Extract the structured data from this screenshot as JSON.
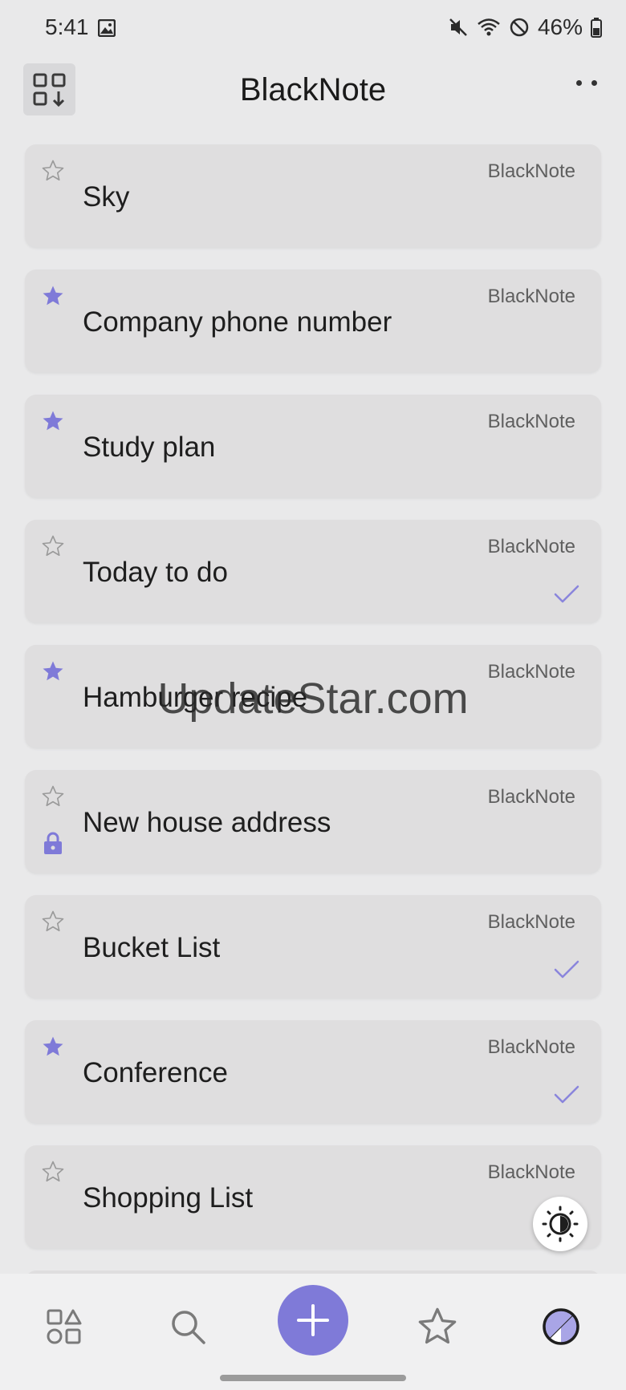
{
  "status_bar": {
    "time": "5:41",
    "battery": "46%"
  },
  "app_bar": {
    "title": "BlackNote"
  },
  "notes": [
    {
      "title": "Sky",
      "folder": "BlackNote",
      "starred": false,
      "checked": false,
      "locked": false
    },
    {
      "title": "Company phone number",
      "folder": "BlackNote",
      "starred": true,
      "checked": false,
      "locked": false
    },
    {
      "title": "Study plan",
      "folder": "BlackNote",
      "starred": true,
      "checked": false,
      "locked": false
    },
    {
      "title": "Today to do",
      "folder": "BlackNote",
      "starred": false,
      "checked": true,
      "locked": false
    },
    {
      "title": "Hamburger recipe",
      "folder": "BlackNote",
      "starred": true,
      "checked": false,
      "locked": false
    },
    {
      "title": "New house address",
      "folder": "BlackNote",
      "starred": false,
      "checked": false,
      "locked": true
    },
    {
      "title": "Bucket List",
      "folder": "BlackNote",
      "starred": false,
      "checked": true,
      "locked": false
    },
    {
      "title": "Conference",
      "folder": "BlackNote",
      "starred": true,
      "checked": true,
      "locked": false
    },
    {
      "title": "Shopping List",
      "folder": "BlackNote",
      "starred": false,
      "checked": false,
      "locked": false
    }
  ],
  "watermark": "UpdateStar.com",
  "colors": {
    "accent": "#7f7ad8",
    "card": "#dfdedf",
    "background": "#e9e9ea",
    "star_empty": "#9a9a9a"
  },
  "icons": {
    "view_toggle": "grid-sort-icon",
    "nav": [
      "categories-icon",
      "search-icon",
      "add-icon",
      "star-icon",
      "theme-icon"
    ],
    "fab": "brightness-contrast-icon"
  }
}
